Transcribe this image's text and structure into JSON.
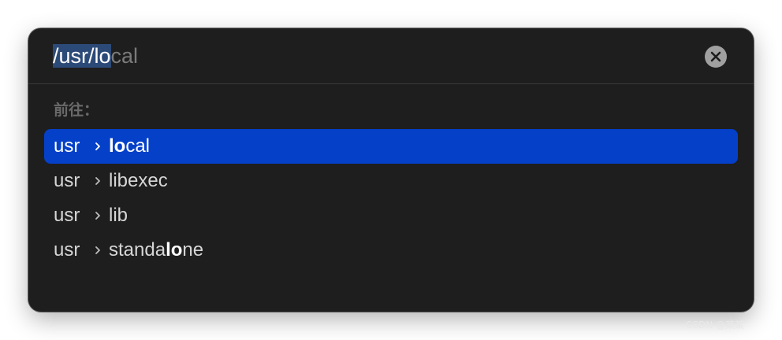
{
  "path_field": {
    "typed": "/usr/lo",
    "completion": "cal"
  },
  "clear_button_icon": "close-icon",
  "section_label": "前往：",
  "results": [
    {
      "parent": "usr",
      "name_before": "",
      "name_match": "lo",
      "name_after": "cal",
      "selected": true
    },
    {
      "parent": "usr",
      "name_before": "",
      "name_match": "",
      "name_after": "libexec",
      "selected": false
    },
    {
      "parent": "usr",
      "name_before": "",
      "name_match": "",
      "name_after": "lib",
      "selected": false
    },
    {
      "parent": "usr",
      "name_before": "standa",
      "name_match": "lo",
      "name_after": "ne",
      "selected": false
    }
  ],
  "watermark": "CSDN @某某",
  "colors": {
    "selection_bg": "#0540c9",
    "text_selection_bg": "#2c4a78",
    "dialog_bg": "#1e1e1e"
  }
}
